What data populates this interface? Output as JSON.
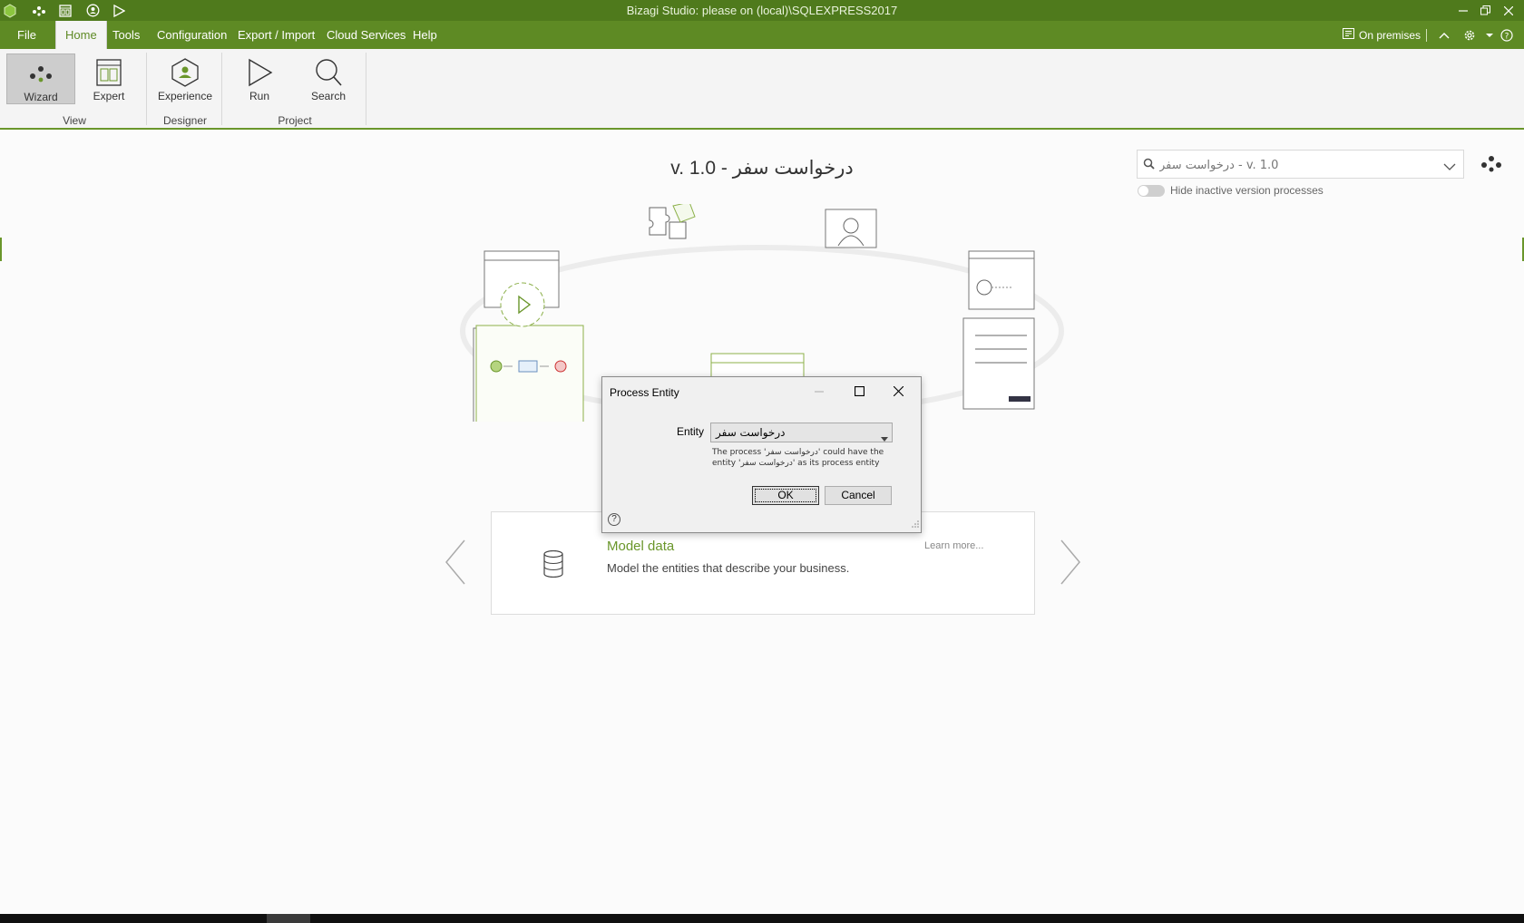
{
  "titlebar": {
    "title": "Bizagi Studio: please  on (local)\\SQLEXPRESS2017",
    "quick_access": [
      "app-logo-icon",
      "wizard-icon",
      "expert-icon",
      "experience-icon",
      "run-icon"
    ],
    "window_buttons": [
      "minimize-icon",
      "restore-icon",
      "close-icon"
    ]
  },
  "menubar": {
    "items": [
      "File",
      "Home",
      "Tools",
      "Configuration",
      "Export / Import",
      "Cloud Services",
      "Help"
    ],
    "active": "Home",
    "environment": "On premises"
  },
  "ribbon": {
    "buttons": [
      {
        "label": "Wizard",
        "icon": "wizard-icon",
        "selected": true
      },
      {
        "label": "Expert",
        "icon": "expert-icon",
        "selected": false
      },
      {
        "label": "Experience",
        "icon": "experience-icon",
        "selected": false
      },
      {
        "label": "Run",
        "icon": "run-icon",
        "selected": false
      },
      {
        "label": "Search",
        "icon": "search-icon",
        "selected": false
      }
    ],
    "groups": [
      "View",
      "Designer",
      "Project"
    ]
  },
  "main": {
    "title": "درخواست سفر - v. 1.0",
    "search_value": "درخواست سفر - v. 1.0",
    "hide_inactive_label": "Hide inactive version processes",
    "hide_inactive_on": false
  },
  "card": {
    "title": "Model data",
    "description": "Model the entities that describe your business.",
    "learn_more": "Learn more..."
  },
  "dialog": {
    "title": "Process Entity",
    "entity_label": "Entity",
    "entity_value": "درخواست سفر",
    "note": "The process 'درخواست سفر' could have the entity 'درخواست سفر' as its process entity",
    "ok_label": "OK",
    "cancel_label": "Cancel",
    "help_label": "?"
  },
  "colors": {
    "titlebar": "#4f7a1c",
    "menubar": "#5e8a24",
    "accent": "#6a962b"
  }
}
